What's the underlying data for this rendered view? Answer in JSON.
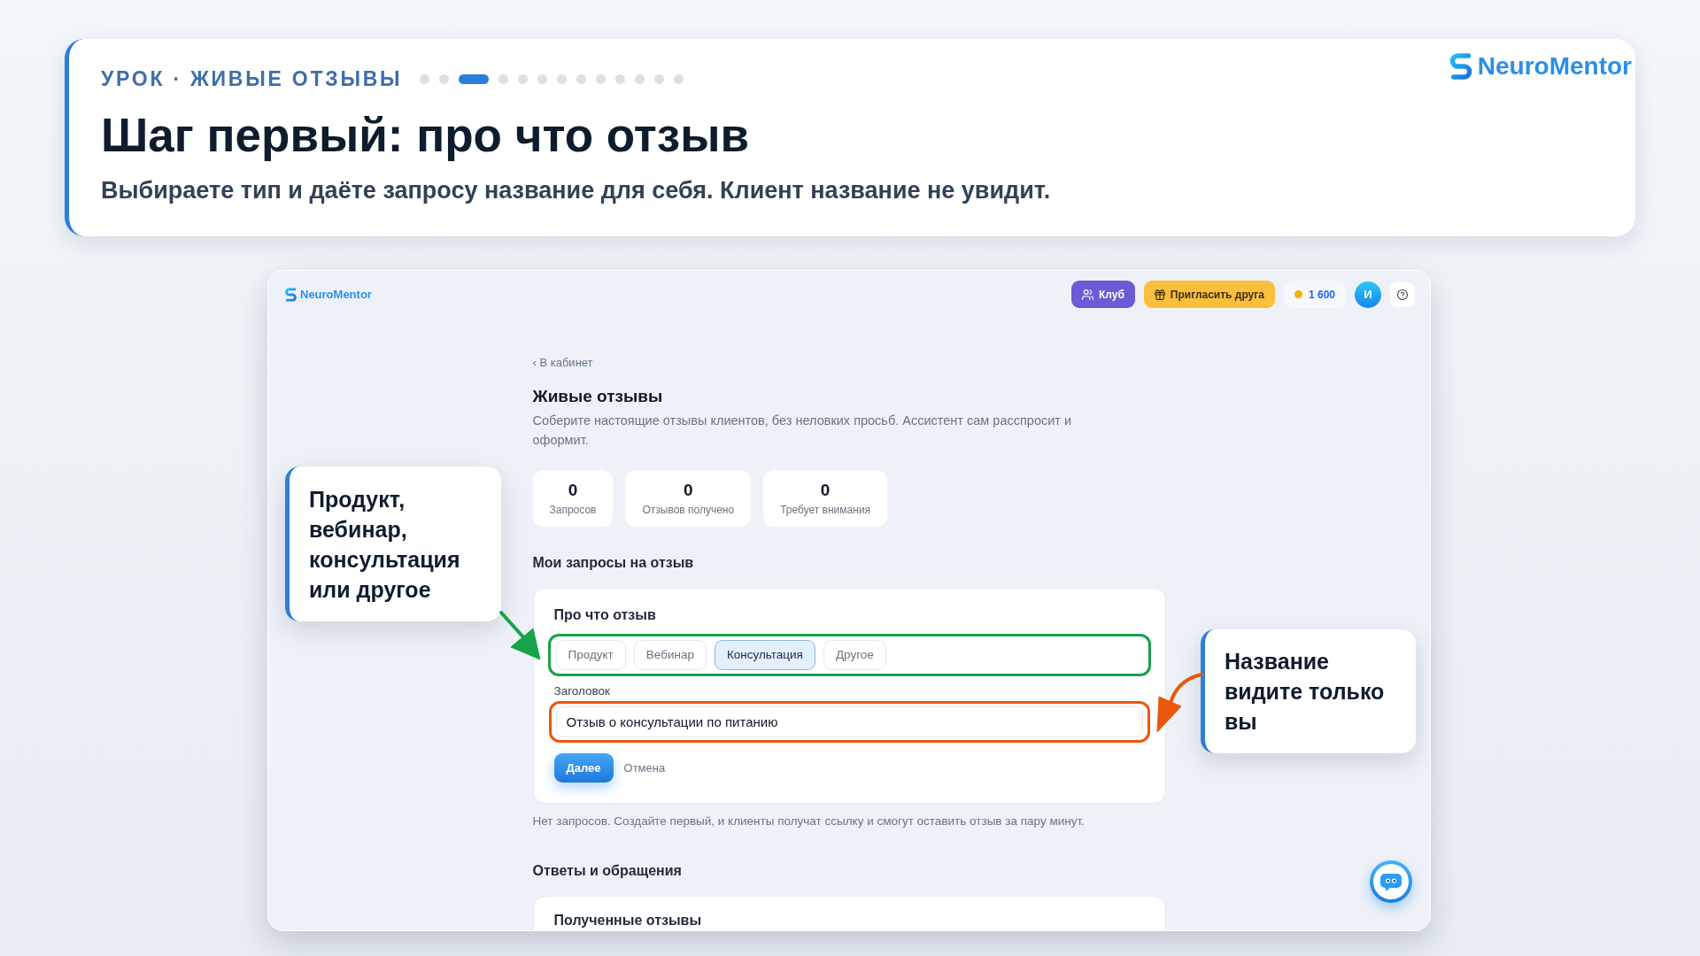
{
  "lesson_header": {
    "eyebrow": "УРОК · ЖИВЫЕ ОТЗЫВЫ",
    "progress_dots": [
      {
        "selected": false
      },
      {
        "selected": false
      },
      {
        "selected": true
      },
      {
        "selected": false
      },
      {
        "selected": false
      },
      {
        "selected": false
      },
      {
        "selected": false
      },
      {
        "selected": false
      },
      {
        "selected": false
      },
      {
        "selected": false
      },
      {
        "selected": false
      },
      {
        "selected": false
      },
      {
        "selected": false
      }
    ],
    "title": "Шаг первый: про что отзыв",
    "subtitle": "Выбираете тип и даёте запросу название для себя. Клиент название не увидит."
  },
  "brand": {
    "name": "NeuroMentor"
  },
  "app": {
    "logo": "NeuroMentor",
    "top_bar": {
      "club": "Клуб",
      "invite": "Пригласить друга",
      "coins": "1 600",
      "avatar": "И"
    },
    "back_link": "‹ В кабинет",
    "title": "Живые отзывы",
    "description": "Соберите настоящие отзывы клиентов, без неловких просьб. Ассистент сам расспросит и оформит.",
    "stats": [
      {
        "value": "0",
        "label": "Запросов"
      },
      {
        "value": "0",
        "label": "Отзывов получено"
      },
      {
        "value": "0",
        "label": "Требует внимания"
      }
    ],
    "requests": {
      "heading": "Мои запросы на отзыв",
      "form": {
        "heading": "Про что отзыв",
        "types": [
          {
            "label": "Продукт",
            "selected": false
          },
          {
            "label": "Вебинар",
            "selected": false
          },
          {
            "label": "Консультация",
            "selected": true
          },
          {
            "label": "Другое",
            "selected": false
          }
        ],
        "title_label": "Заголовок",
        "title_value": "Отзыв о консультации по питанию",
        "submit": "Далее",
        "cancel": "Отмена"
      },
      "empty_note": "Нет запросов. Создайте первый, и клиенты получат ссылку и смогут оставить отзыв за пару минут."
    },
    "responses": {
      "heading": "Ответы и обращения",
      "card_heading": "Полученные отзывы"
    }
  },
  "callouts": [
    {
      "text": "Продукт, вебинар, консультация или другое",
      "color": "#16a34a"
    },
    {
      "text": "Название видите только вы",
      "color": "#ea580c"
    }
  ]
}
